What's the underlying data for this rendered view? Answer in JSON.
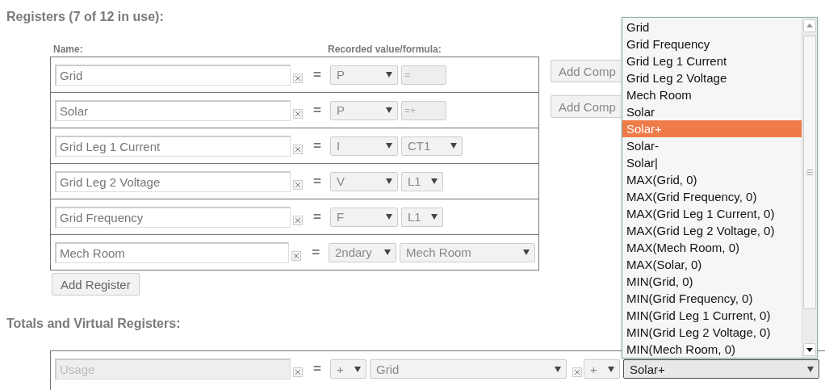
{
  "registers": {
    "title": "Registers (7 of 12 in use):",
    "columns": [
      "Name:",
      "Recorded value/formula:"
    ],
    "rows": [
      {
        "name": "Grid",
        "equals": "=",
        "type": "P",
        "kind": "formula",
        "value": "=",
        "action": "Add Comp"
      },
      {
        "name": "Solar",
        "equals": "=",
        "type": "P",
        "kind": "formula",
        "value": "=+",
        "action": "Add Comp"
      },
      {
        "name": "Grid Leg 1 Current",
        "equals": "=",
        "type": "I",
        "kind": "select",
        "value": "CT1"
      },
      {
        "name": "Grid Leg 2 Voltage",
        "equals": "=",
        "type": "V",
        "kind": "select",
        "value": "L1"
      },
      {
        "name": "Grid Frequency",
        "equals": "=",
        "type": "F",
        "kind": "select",
        "value": "L1"
      },
      {
        "name": "Mech Room",
        "equals": "=",
        "type": "2ndary",
        "kind": "select",
        "value": "Mech Room"
      }
    ],
    "add_button": "Add Register"
  },
  "totals": {
    "title": "Totals and Virtual Registers:",
    "rows": [
      {
        "name": "Usage",
        "disabled": true,
        "equals": "=",
        "terms": [
          {
            "op": "+",
            "operand": "Grid",
            "removable": true,
            "open": false
          },
          {
            "op": "+",
            "operand": "Solar+",
            "removable": false,
            "open": true
          }
        ]
      }
    ]
  },
  "dropdown": {
    "options": [
      {
        "label": "Grid",
        "selected": false
      },
      {
        "label": "Grid Frequency",
        "selected": false
      },
      {
        "label": "Grid Leg 1 Current",
        "selected": false
      },
      {
        "label": "Grid Leg 2 Voltage",
        "selected": false
      },
      {
        "label": "Mech Room",
        "selected": false
      },
      {
        "label": "Solar",
        "selected": false
      },
      {
        "label": "Solar+",
        "selected": true
      },
      {
        "label": "Solar-",
        "selected": false
      },
      {
        "label": "Solar|",
        "selected": false
      },
      {
        "label": "MAX(Grid, 0)",
        "selected": false
      },
      {
        "label": "MAX(Grid Frequency, 0)",
        "selected": false
      },
      {
        "label": "MAX(Grid Leg 1 Current, 0)",
        "selected": false
      },
      {
        "label": "MAX(Grid Leg 2 Voltage, 0)",
        "selected": false
      },
      {
        "label": "MAX(Mech Room, 0)",
        "selected": false
      },
      {
        "label": "MAX(Solar, 0)",
        "selected": false
      },
      {
        "label": "MIN(Grid, 0)",
        "selected": false
      },
      {
        "label": "MIN(Grid Frequency, 0)",
        "selected": false
      },
      {
        "label": "MIN(Grid Leg 1 Current, 0)",
        "selected": false
      },
      {
        "label": "MIN(Grid Leg 2 Voltage, 0)",
        "selected": false
      },
      {
        "label": "MIN(Mech Room, 0)",
        "selected": false
      }
    ]
  }
}
